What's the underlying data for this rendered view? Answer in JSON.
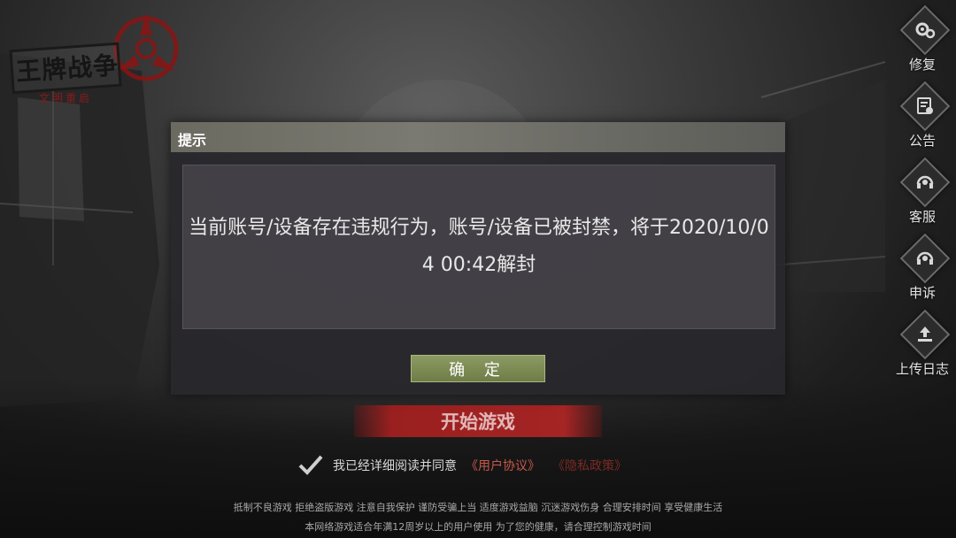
{
  "logo": {
    "title": "王牌战争",
    "subtitle": "文明重启"
  },
  "side_menu": [
    {
      "label": "修复",
      "icon": "gear-icon"
    },
    {
      "label": "公告",
      "icon": "notice-icon"
    },
    {
      "label": "客服",
      "icon": "headset-icon"
    },
    {
      "label": "申诉",
      "icon": "appeal-icon"
    },
    {
      "label": "上传日志",
      "icon": "upload-icon"
    }
  ],
  "dialog": {
    "title": "提示",
    "message": "当前账号/设备存在违规行为，账号/设备已被封禁，将于2020/10/04 00:42解封",
    "confirm_label": "确 定"
  },
  "start_button": {
    "label": "开始游戏"
  },
  "agreement": {
    "text": "我已经详细阅读并同意",
    "user_agreement": "《用户协议》",
    "privacy_policy": "《隐私政策》"
  },
  "footer": {
    "line1": "抵制不良游戏 拒绝盗版游戏 注意自我保护 谨防受骗上当 适度游戏益脑 沉迷游戏伤身 合理安排时间 享受健康生活",
    "line2": "本网络游戏适合年满12周岁以上的用户使用    为了您的健康，请合理控制游戏时间"
  },
  "colors": {
    "accent_red": "#a52424",
    "confirm_green": "#7a8a52",
    "link_red": "#c8584a"
  }
}
